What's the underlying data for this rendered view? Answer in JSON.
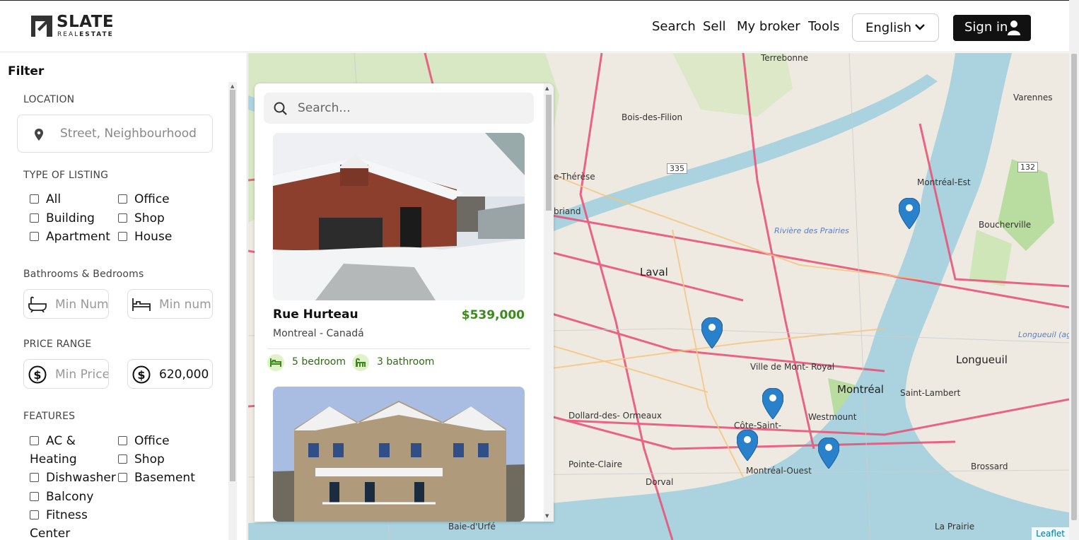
{
  "brand": {
    "title": "SLATE",
    "subtitle_a": "REAL",
    "subtitle_b": "ESTATE"
  },
  "nav": {
    "items": [
      "Search",
      "Sell",
      "My broker",
      "Tools"
    ],
    "language": "English",
    "signin": "Sign in"
  },
  "filter": {
    "title": "Filter",
    "location": {
      "label": "LOCATION",
      "placeholder": "Street, Neighbourhood"
    },
    "type": {
      "label": "TYPE OF LISTING",
      "options": [
        "All",
        "Office",
        "Building",
        "Shop",
        "Apartment",
        "House"
      ]
    },
    "rooms": {
      "label": "Bathrooms & Bedrooms",
      "bath_placeholder": "Min Num",
      "bed_placeholder": "Min num"
    },
    "price": {
      "label": "PRICE RANGE",
      "min_placeholder": "Min Price",
      "max_value": "620,000"
    },
    "features": {
      "label": "FEATURES",
      "options": [
        "AC &",
        "Heating",
        "Office",
        "Shop",
        "Dishwasher",
        "Basement",
        "Balcony",
        "Fitness",
        "Center"
      ]
    }
  },
  "panel": {
    "search_placeholder": "Search...",
    "listings": [
      {
        "title": "Rue Hurteau",
        "price": "$539,000",
        "location": "Montreal - Canadá",
        "bedrooms": "5 bedroom",
        "bathrooms": "3 bathroom"
      }
    ]
  },
  "map": {
    "labels": {
      "terrebonne": "Terrebonne",
      "boisdesfilion": "Bois-des-Filion",
      "therese": "Thérèse-\nDe Blainville",
      "varennes": "Varennes",
      "montrealest": "Montréal-Est",
      "boucherville": "Boucherville",
      "laval": "Laval",
      "riviere": "Rivière\ndes Prairies",
      "villemontroyal": "Ville de Mont-\nRoyal",
      "montreal": "Montréal",
      "longueuil": "Longueuil",
      "longueuilagg": "Longueuil\n(agglomeration)",
      "saintlambert": "Saint-Lambert",
      "westmount": "Westmount",
      "dollard": "Dollard-des-\nOrmeaux",
      "cotesaint": "Côte-Saint-",
      "montrealouest": "Montréal-Ouest",
      "pointeclaire": "Pointe-Claire",
      "dorval": "Dorval",
      "brossard": "Brossard",
      "baie": "Baie-d'Urfé",
      "laprairie": "La Prairie",
      "therese2": "e-Thérèse",
      "briand": "briand",
      "r335": "335",
      "r132": "132"
    },
    "attribution": "Leaflet"
  }
}
